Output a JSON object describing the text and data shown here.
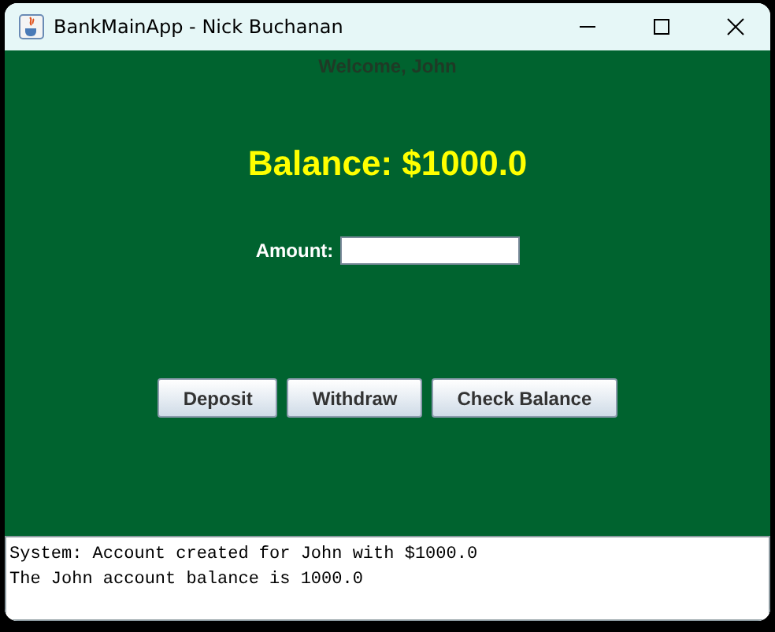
{
  "window": {
    "title": "BankMainApp - Nick Buchanan"
  },
  "welcome": "Welcome, John",
  "balance": "Balance: $1000.0",
  "amount": {
    "label": "Amount:"
  },
  "buttons": [
    "Deposit",
    "Withdraw",
    "Check Balance"
  ],
  "log": [
    "System: Account created for John with $1000.0",
    "The John account balance is 1000.0"
  ]
}
